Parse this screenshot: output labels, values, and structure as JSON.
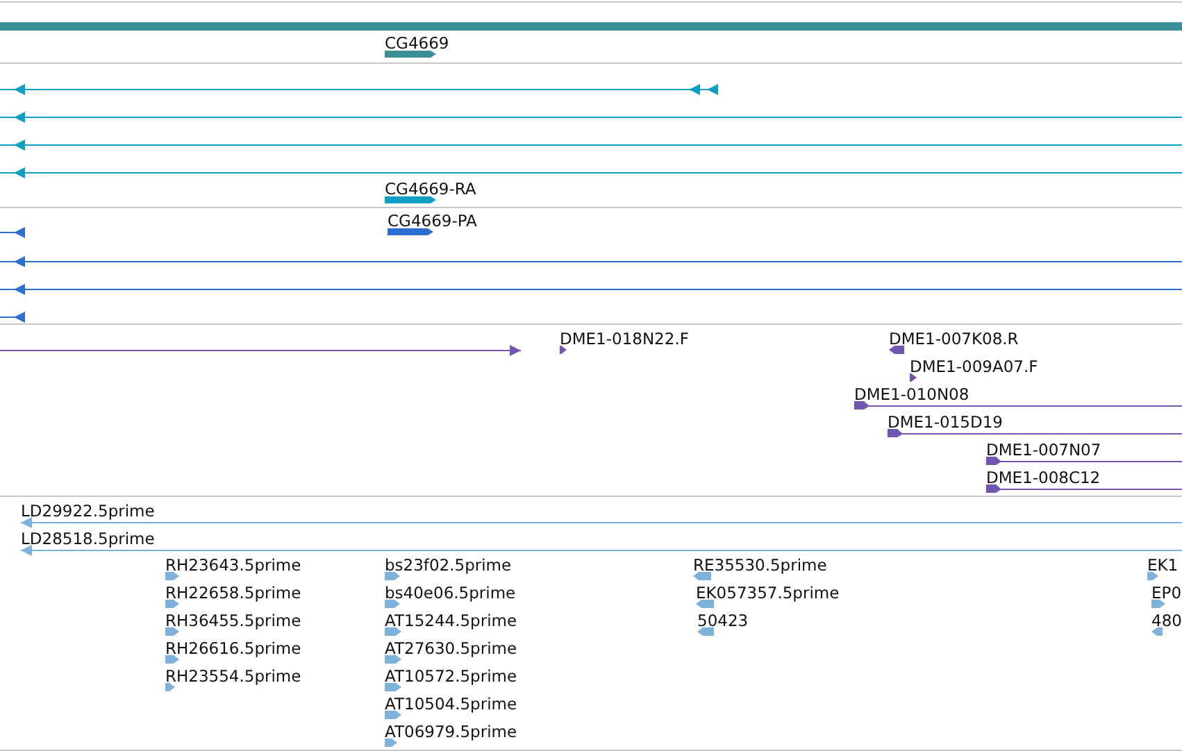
{
  "tracks": [
    {
      "color": "#3a8f96",
      "features": [
        {
          "kind": "bar"
        },
        {
          "kind": "block",
          "reverse": false,
          "label": "CG4669"
        }
      ]
    },
    {
      "color": "#0e9fc2",
      "features": [
        {
          "kind": "line",
          "reverse": true
        },
        {
          "kind": "line",
          "reverse": true
        },
        {
          "kind": "line",
          "reverse": true
        },
        {
          "kind": "line",
          "reverse": true
        },
        {
          "kind": "block",
          "reverse": false,
          "label": "CG4669-RA"
        }
      ]
    },
    {
      "color": "#2c6fd1",
      "features": [
        {
          "kind": "line",
          "reverse": true
        },
        {
          "kind": "block",
          "reverse": false,
          "label": "CG4669-PA"
        },
        {
          "kind": "line",
          "reverse": true
        },
        {
          "kind": "line",
          "reverse": true
        },
        {
          "kind": "line",
          "reverse": true
        }
      ]
    },
    {
      "color": "#7255b0",
      "features": [
        {
          "kind": "line",
          "reverse": false
        },
        {
          "kind": "tick",
          "reverse": false,
          "label": "DME1-018N22.F"
        },
        {
          "kind": "tick",
          "reverse": true,
          "label": "DME1-007K08.R"
        },
        {
          "kind": "tick",
          "reverse": false,
          "label": "DME1-009A07.F"
        },
        {
          "kind": "line",
          "reverse": false,
          "label": "DME1-010N08"
        },
        {
          "kind": "line",
          "reverse": false,
          "label": "DME1-015D19"
        },
        {
          "kind": "line",
          "reverse": false,
          "label": "DME1-007N07"
        },
        {
          "kind": "line",
          "reverse": false,
          "label": "DME1-008C12"
        }
      ]
    },
    {
      "color": "#7fb2da",
      "features": [
        {
          "kind": "line",
          "reverse": true,
          "label": "LD29922.5prime"
        },
        {
          "kind": "line",
          "reverse": true,
          "label": "LD28518.5prime"
        },
        {
          "kind": "tick",
          "reverse": false,
          "label": "RH23643.5prime"
        },
        {
          "kind": "tick",
          "reverse": false,
          "label": "RH22658.5prime"
        },
        {
          "kind": "tick",
          "reverse": false,
          "label": "RH36455.5prime"
        },
        {
          "kind": "tick",
          "reverse": false,
          "label": "RH26616.5prime"
        },
        {
          "kind": "tick",
          "reverse": false,
          "label": "RH23554.5prime"
        },
        {
          "kind": "tick",
          "reverse": false,
          "label": "bs23f02.5prime"
        },
        {
          "kind": "tick",
          "reverse": false,
          "label": "bs40e06.5prime"
        },
        {
          "kind": "tick",
          "reverse": false,
          "label": "AT15244.5prime"
        },
        {
          "kind": "tick",
          "reverse": false,
          "label": "AT27630.5prime"
        },
        {
          "kind": "tick",
          "reverse": false,
          "label": "AT10572.5prime"
        },
        {
          "kind": "tick",
          "reverse": false,
          "label": "AT10504.5prime"
        },
        {
          "kind": "tick",
          "reverse": false,
          "label": "AT06979.5prime"
        },
        {
          "kind": "tick",
          "reverse": true,
          "label": "RE35530.5prime"
        },
        {
          "kind": "tick",
          "reverse": true,
          "label": "EK057357.5prime"
        },
        {
          "kind": "tick",
          "reverse": true,
          "label": "50423"
        },
        {
          "kind": "tick",
          "reverse": false,
          "label": "EK1"
        },
        {
          "kind": "tick",
          "reverse": false,
          "label": "EP0"
        },
        {
          "kind": "tick",
          "reverse": true,
          "label": "480"
        }
      ]
    }
  ]
}
